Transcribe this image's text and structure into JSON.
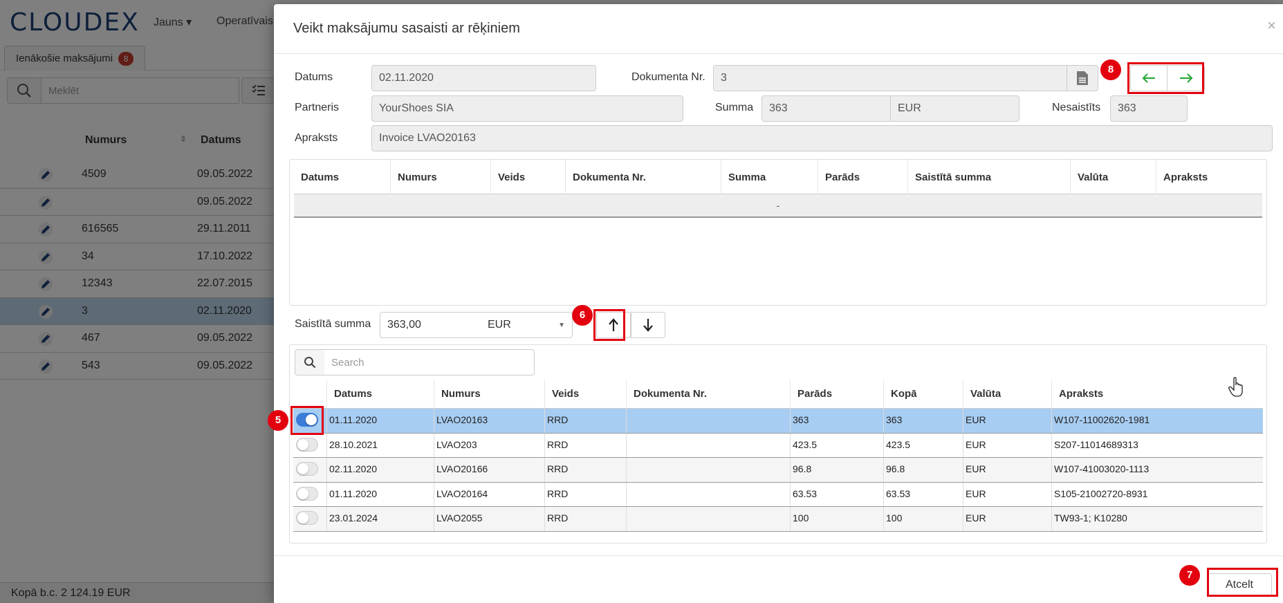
{
  "app": {
    "logo": "CLOUDEX",
    "menu": [
      "Jauns ▾",
      "Operatīvais"
    ],
    "tab": {
      "label": "Ienākošie maksājumi",
      "count": "8"
    },
    "search_placeholder": "Meklēt",
    "columns": [
      "Numurs",
      "Datums"
    ],
    "rows": [
      {
        "num": "4509",
        "date": "09.05.2022"
      },
      {
        "num": "",
        "date": "09.05.2022"
      },
      {
        "num": "616565",
        "date": "29.11.2011"
      },
      {
        "num": "34",
        "date": "17.10.2022"
      },
      {
        "num": "12343",
        "date": "22.07.2015"
      },
      {
        "num": "3",
        "date": "02.11.2020"
      },
      {
        "num": "467",
        "date": "09.05.2022"
      },
      {
        "num": "543",
        "date": "09.05.2022"
      }
    ],
    "footer": "Kopā b.c. 2 124.19 EUR"
  },
  "modal": {
    "title": "Veikt maksājumu sasaisti ar rēķiniem",
    "close": "×",
    "form": {
      "datums_label": "Datums",
      "datums_value": "02.11.2020",
      "doknr_label": "Dokumenta Nr.",
      "doknr_value": "3",
      "partneris_label": "Partneris",
      "partneris_value": "YourShoes SIA",
      "summa_label": "Summa",
      "summa_value": "363",
      "summa_currency": "EUR",
      "nesaistits_label": "Nesaistīts",
      "nesaistits_value": "363",
      "apraksts_label": "Apraksts",
      "apraksts_value": "Invoice LVAO20163"
    },
    "linked_table": {
      "columns": [
        "Datums",
        "Numurs",
        "Veids",
        "Dokumenta Nr.",
        "Summa",
        "Parāds",
        "Saistītā summa",
        "Valūta",
        "Apraksts"
      ],
      "empty_text": "-"
    },
    "link": {
      "label": "Saistītā summa",
      "amount": "363,00",
      "currency": "EUR"
    },
    "invoices": {
      "search_placeholder": "Search",
      "columns": [
        "Datums",
        "Numurs",
        "Veids",
        "Dokumenta Nr.",
        "Parāds",
        "Kopā",
        "Valūta",
        "Apraksts"
      ],
      "rows": [
        {
          "on": true,
          "date": "01.11.2020",
          "num": "LVAO20163",
          "type": "RRD",
          "doc": "",
          "debt": "363",
          "total": "363",
          "cur": "EUR",
          "desc": "W107-11002620-1981"
        },
        {
          "on": false,
          "date": "28.10.2021",
          "num": "LVAO203",
          "type": "RRD",
          "doc": "",
          "debt": "423.5",
          "total": "423.5",
          "cur": "EUR",
          "desc": "S207-11014689313"
        },
        {
          "on": false,
          "date": "02.11.2020",
          "num": "LVAO20166",
          "type": "RRD",
          "doc": "",
          "debt": "96.8",
          "total": "96.8",
          "cur": "EUR",
          "desc": "W107-41003020-1113"
        },
        {
          "on": false,
          "date": "01.11.2020",
          "num": "LVAO20164",
          "type": "RRD",
          "doc": "",
          "debt": "63.53",
          "total": "63.53",
          "cur": "EUR",
          "desc": "S105-21002720-8931"
        },
        {
          "on": false,
          "date": "23.01.2024",
          "num": "LVAO2055",
          "type": "RRD",
          "doc": "",
          "debt": "100",
          "total": "100",
          "cur": "EUR",
          "desc": "TW93-1; K10280"
        }
      ]
    },
    "cancel_label": "Atcelt"
  },
  "callouts": [
    "5",
    "6",
    "7",
    "8"
  ],
  "colors": {
    "accent_red": "#e3000f",
    "nav_arrow": "#2eaa3c",
    "selected_row": "#a8cdf2",
    "toggle_on": "#3b7dd8"
  }
}
